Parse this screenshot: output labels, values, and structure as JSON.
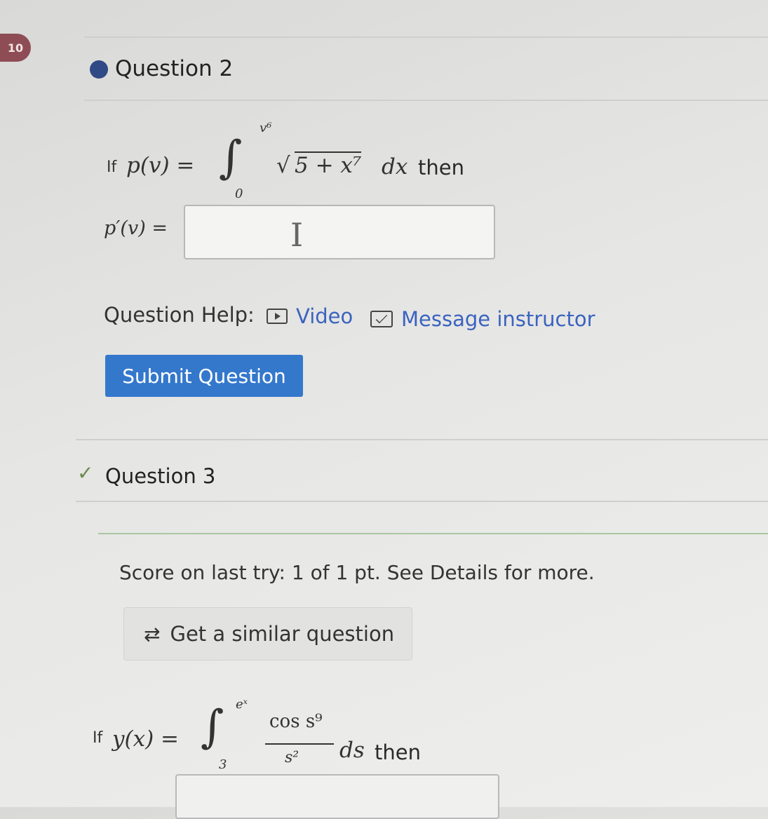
{
  "badge": {
    "number": "10"
  },
  "question2": {
    "title": "Question 2",
    "prompt_if": "If",
    "lhs": "p(v) =",
    "lower_limit": "0",
    "upper_limit": "v⁶",
    "integrand_sqrt": "5 + x⁷",
    "differential": "dx",
    "then": "then",
    "answer_label": "p′(v) =",
    "answer_value": "",
    "help_label": "Question Help:",
    "video_label": "Video",
    "message_label": "Message instructor",
    "submit_label": "Submit Question"
  },
  "question3": {
    "title": "Question 3",
    "score_text": "Score on last try: 1 of 1 pt. See Details for more.",
    "similar_label": "Get a similar question",
    "prompt_if": "If",
    "lhs": "y(x) =",
    "lower_limit": "3",
    "upper_limit": "eˣ",
    "numerator": "cos s⁹",
    "denominator": "s²",
    "differential": "ds",
    "then": "then"
  },
  "colors": {
    "accent_blue": "#3478cc",
    "link_blue": "#3b63c0",
    "badge": "#8e4d55",
    "dot": "#2f4a85"
  },
  "icons": {
    "video": "video-icon",
    "message": "envelope-icon",
    "similar": "refresh-icon",
    "check": "check-icon",
    "cursor": "text-cursor-icon"
  }
}
